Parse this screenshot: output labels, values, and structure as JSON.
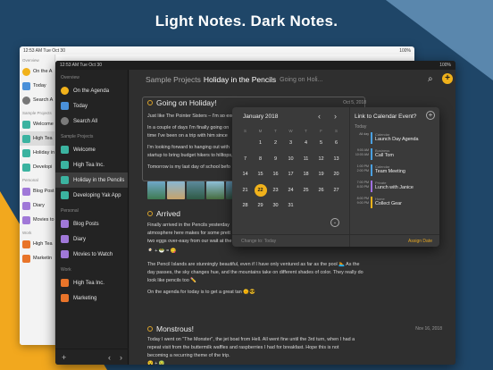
{
  "headline": "Light Notes. Dark Notes.",
  "colors": {
    "accent": "#f1b21b",
    "background": "#1f4668",
    "orange": "#f2a81e"
  },
  "light_app": {
    "status_time": "12:53 AM  Tue Oct 30",
    "status_battery": "100%",
    "sidebar": {
      "section1": "Overview",
      "items": [
        {
          "label": "On the A",
          "icon": "circle-orange-icon"
        },
        {
          "label": "Today",
          "icon": "calendar-icon"
        },
        {
          "label": "Search A",
          "icon": "search-icon"
        }
      ],
      "section2": "Sample Projects",
      "projects": [
        {
          "label": "Welcome",
          "icon": "notebook-icon"
        },
        {
          "label": "High Tea",
          "icon": "notebook-icon"
        },
        {
          "label": "Holiday in",
          "icon": "notebook-icon"
        },
        {
          "label": "Developi",
          "icon": "notebook-icon"
        }
      ],
      "section3": "Personal",
      "personal": [
        {
          "label": "Blog Post",
          "icon": "notebook-icon"
        },
        {
          "label": "Diary",
          "icon": "notebook-icon"
        },
        {
          "label": "Movies to",
          "icon": "notebook-icon"
        }
      ],
      "section4": "Work",
      "work": [
        {
          "label": "High Tea",
          "icon": "notebook-icon"
        },
        {
          "label": "Marketin",
          "icon": "notebook-icon"
        }
      ]
    }
  },
  "dark_app": {
    "status_time": "12:53 AM  Tue Oct 30",
    "status_battery": "100%",
    "sidebar": {
      "overview_head": "Overview",
      "overview": [
        {
          "label": "On the Agenda",
          "icon": "agenda-icon"
        },
        {
          "label": "Today",
          "icon": "today-icon"
        },
        {
          "label": "Search All",
          "icon": "search-icon"
        }
      ],
      "projects_head": "Sample Projects",
      "projects": [
        {
          "label": "Welcome",
          "icon": "notebook-icon"
        },
        {
          "label": "High Tea Inc.",
          "icon": "notebook-icon"
        },
        {
          "label": "Holiday in the Pencils",
          "icon": "notebook-icon",
          "selected": true
        },
        {
          "label": "Developing Yak App",
          "icon": "notebook-icon"
        }
      ],
      "personal_head": "Personal",
      "personal": [
        {
          "label": "Blog Posts",
          "icon": "notebook-icon"
        },
        {
          "label": "Diary",
          "icon": "notebook-icon"
        },
        {
          "label": "Movies to Watch",
          "icon": "notebook-icon"
        }
      ],
      "work_head": "Work",
      "work": [
        {
          "label": "High Tea Inc.",
          "icon": "notebook-icon"
        },
        {
          "label": "Marketing",
          "icon": "notebook-icon"
        }
      ],
      "footer_add": "+",
      "footer_back": "‹",
      "footer_forward": "›"
    },
    "topbar": {
      "project": "Sample Projects",
      "title": "Holiday in the Pencils",
      "subtitle": "Going on Holi...",
      "add": "+"
    },
    "notes": [
      {
        "title": "Going on Holiday!",
        "date": "Oct 5, 2018",
        "lines": [
          "Just like The Pointer Sisters – I'm so exc",
          "In a couple of days I'm finally going on",
          "time I've been on a trip with him since",
          "I'm looking forward to hanging out with",
          "startup to bring budget hikers to hilltops, or s",
          "Tomorrow is my last day of school befo"
        ]
      },
      {
        "title": "Arrived",
        "date": "",
        "lines": [
          "Finally arrived in the Pencils yesterday",
          "atmosphere here makes for some prett",
          "two eggs over-easy from our wait at the",
          "🍳 + 🥗 = 😋",
          "The Pencil Islands are stunningly beautiful, even if I have only ventured as far as the pool 🏊 As the",
          "day passes, the sky changes hue, and the mountains take on different shades of color. They really do",
          "look like pencils too ✏️",
          "On the agenda for today is to get a great tan 🌞😎"
        ]
      },
      {
        "title": "Monstrous!",
        "date": "Nov 16, 2018",
        "lines": [
          "Today I went on \"The Monster\", the jet boat from Hell. All went fine until the 3rd turn, when I had a",
          "repeat visit from the buttermilk waffles and raspberries I had for breakfast. Hope this is not",
          "becoming a recurring theme of the trip.",
          "😵 + 🤢"
        ]
      }
    ],
    "calendar": {
      "month": "January 2018",
      "prev": "‹",
      "next": "›",
      "dow": [
        "S",
        "M",
        "T",
        "W",
        "T",
        "F",
        "S"
      ],
      "days": [
        "",
        "1",
        "2",
        "3",
        "4",
        "5",
        "6",
        "7",
        "8",
        "9",
        "10",
        "11",
        "12",
        "13",
        "14",
        "15",
        "16",
        "17",
        "18",
        "19",
        "20",
        "21",
        "22",
        "23",
        "24",
        "25",
        "26",
        "27",
        "28",
        "29",
        "30",
        "31",
        "",
        "",
        ""
      ],
      "today": "22",
      "change": "Change to: Today",
      "assign": "Assign Date",
      "expand": "⌄"
    },
    "events": {
      "title": "Link to Calendar Event?",
      "today_label": "Today",
      "add": "+",
      "items": [
        {
          "time": "All day",
          "calendar": "Calendar",
          "name": "Launch Day Agenda",
          "color": "#4aa0e0"
        },
        {
          "time": "9:00 AM\n10:00 AM",
          "calendar": "Business",
          "name": "Call Tom",
          "color": "#4aa0e0"
        },
        {
          "time": "1:00 PM\n2:00 PM",
          "calendar": "Calendar",
          "name": "Team Meeting",
          "color": "#4aa0e0"
        },
        {
          "time": "7:00 PM\n8:30 PM",
          "calendar": "Private",
          "name": "Lunch with Janice",
          "color": "#a070e0"
        },
        {
          "time": "8:00 PM\n9:00 PM",
          "calendar": "Home",
          "name": "Collect Gear",
          "color": "#f1b21b"
        }
      ]
    }
  }
}
